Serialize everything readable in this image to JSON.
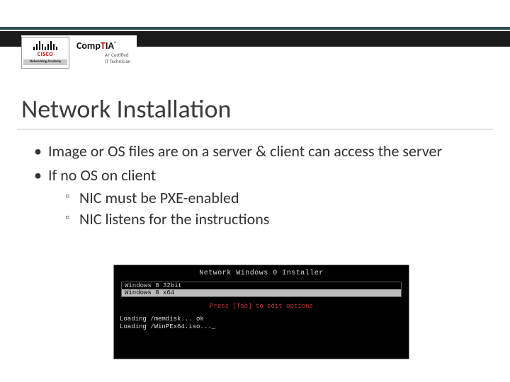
{
  "logos": {
    "cisco": {
      "name": "CISCO",
      "subline": "Networking\nAcademy"
    },
    "comptia": {
      "brand_pre": "Comp",
      "brand_red": "T",
      "brand_post": "IA",
      "tag1": "A+ Certified",
      "tag2": "IT Technician"
    }
  },
  "title": "Network Installation",
  "bullets": {
    "b1": "Image or OS files are on a server & client can access the server",
    "b2": "If no OS on client",
    "b2a": "NIC must be PXE-enabled",
    "b2b": "NIC listens for the instructions"
  },
  "terminal": {
    "header": "Network Windows 0 Installer",
    "opt1": "Windows 8 32bit",
    "opt2": "Windows 8 x64",
    "hint": "Press [Tab] to edit options",
    "log": "Loading /memdisk... ok\nLoading /WinPEx64.iso..._"
  }
}
